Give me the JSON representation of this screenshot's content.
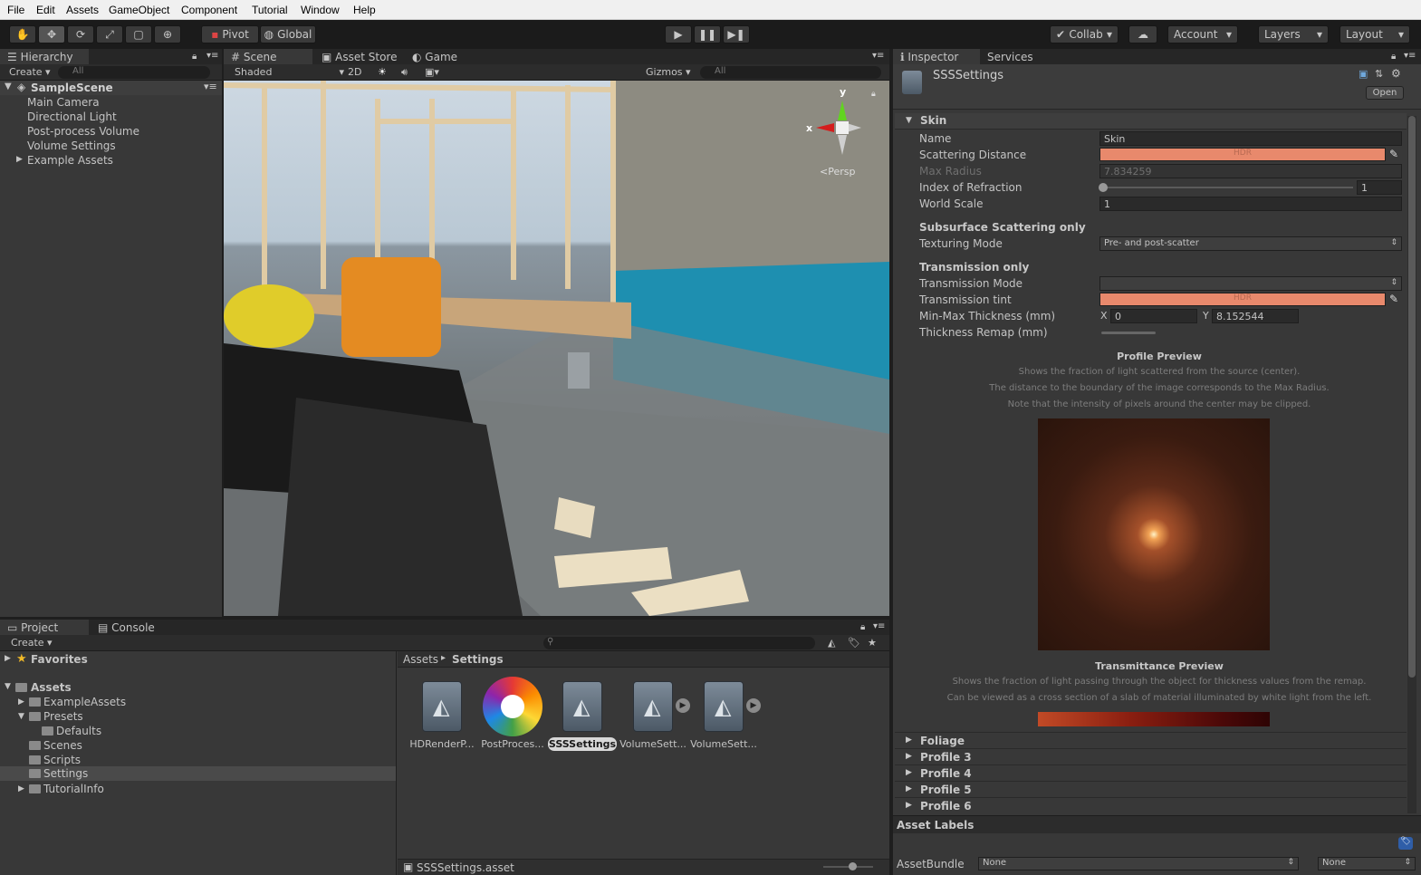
{
  "menubar": [
    "File",
    "Edit",
    "Assets",
    "GameObject",
    "Component",
    "Tutorial",
    "Window",
    "Help"
  ],
  "toolbar": {
    "pivot": "Pivot",
    "global": "Global",
    "collab": "Collab",
    "account": "Account",
    "layers": "Layers",
    "layout": "Layout"
  },
  "hierarchy": {
    "tab": "Hierarchy",
    "create": "Create",
    "search": "All",
    "scene": "SampleScene",
    "items": [
      "Main Camera",
      "Directional Light",
      "Post-process Volume",
      "Volume Settings",
      "Example Assets"
    ]
  },
  "scene": {
    "tabs": [
      "Scene",
      "Asset Store",
      "Game"
    ],
    "shading": "Shaded",
    "mode2d": "2D",
    "gizmos": "Gizmos",
    "search": "All",
    "gizmo_x": "x",
    "gizmo_y": "y",
    "persp": "Persp"
  },
  "project": {
    "tabs": [
      "Project",
      "Console"
    ],
    "create": "Create",
    "favorites": "Favorites",
    "assets": "Assets",
    "tree": [
      "ExampleAssets",
      "Presets",
      "Defaults",
      "Scenes",
      "Scripts",
      "Settings",
      "TutorialInfo"
    ],
    "breadcrumb": [
      "Assets",
      "Settings"
    ],
    "files": [
      "HDRenderP...",
      "PostProces...",
      "SSSSettings",
      "VolumeSett...",
      "VolumeSett..."
    ],
    "statusbar": "SSSSettings.asset"
  },
  "inspector": {
    "tabs": [
      "Inspector",
      "Services"
    ],
    "title": "SSSSettings",
    "open": "Open",
    "section": "Skin",
    "name_label": "Name",
    "name_value": "Skin",
    "scattering_label": "Scattering Distance",
    "hdr": "HDR",
    "maxradius_label": "Max Radius",
    "maxradius_value": "7.834259",
    "ior_label": "Index of Refraction",
    "ior_value": "1",
    "worldscale_label": "World Scale",
    "worldscale_value": "1",
    "sss_header": "Subsurface Scattering only",
    "texturing_label": "Texturing Mode",
    "texturing_value": "Pre- and post-scatter",
    "trans_header": "Transmission only",
    "transmode_label": "Transmission Mode",
    "transmode_value": "",
    "transtint_label": "Transmission tint",
    "thickness_label": "Min-Max Thickness (mm)",
    "thickness_x_label": "X",
    "thickness_x": "0",
    "thickness_y_label": "Y",
    "thickness_y": "8.152544",
    "remap_label": "Thickness Remap (mm)",
    "profile_preview_title": "Profile Preview",
    "profile_preview_lines": [
      "Shows the fraction of light scattered from the source (center).",
      "The distance to the boundary of the image corresponds to the Max Radius.",
      "Note that the intensity of pixels around the center may be clipped."
    ],
    "transmit_title": "Transmittance Preview",
    "transmit_lines": [
      "Shows the fraction of light passing through the object for thickness values from the remap.",
      "Can be viewed as a cross section of a slab of material illuminated by white light from the left."
    ],
    "profiles": [
      "Foliage",
      "Profile 3",
      "Profile 4",
      "Profile 5",
      "Profile 6"
    ],
    "asset_labels": "Asset Labels",
    "assetbundle_label": "AssetBundle",
    "assetbundle_value": "None",
    "variant_value": "None"
  },
  "colors": {
    "hdr_swatch": "#e8896c",
    "accent": "#3d6a9e"
  }
}
